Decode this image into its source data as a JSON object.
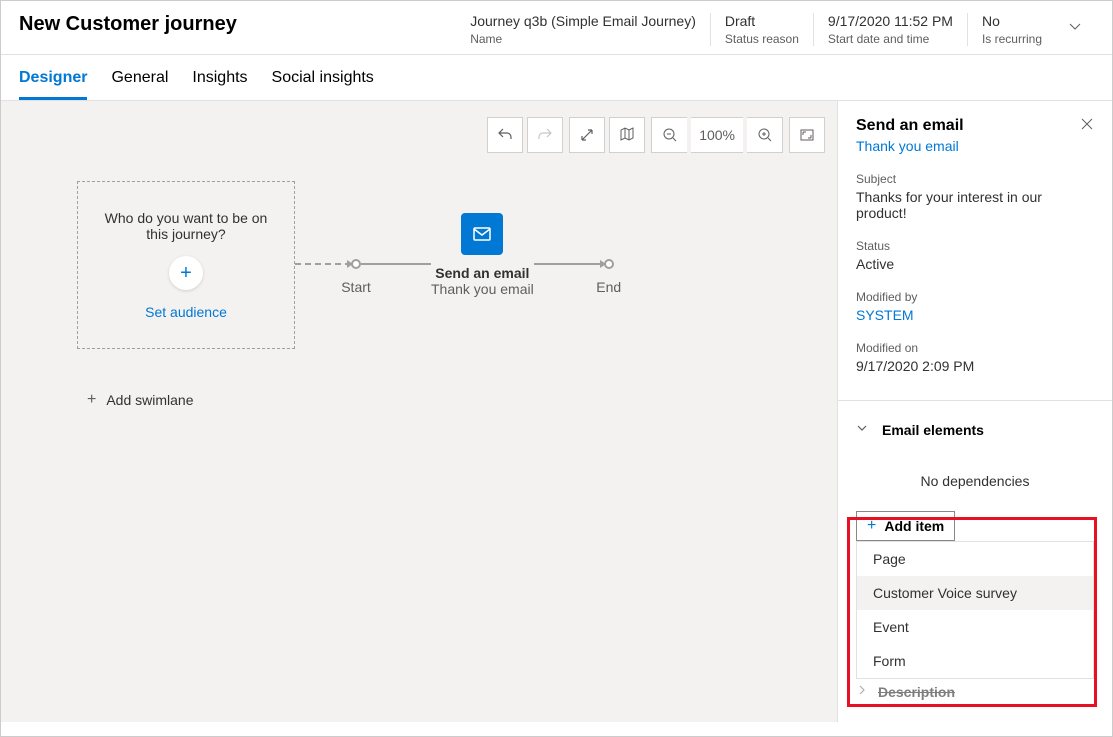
{
  "header": {
    "title": "New Customer journey",
    "meta": [
      {
        "value": "Journey q3b (Simple Email Journey)",
        "label": "Name"
      },
      {
        "value": "Draft",
        "label": "Status reason"
      },
      {
        "value": "9/17/2020 11:52 PM",
        "label": "Start date and time"
      },
      {
        "value": "No",
        "label": "Is recurring"
      }
    ]
  },
  "tabs": [
    "Designer",
    "General",
    "Insights",
    "Social insights"
  ],
  "toolbar": {
    "zoom": "100%"
  },
  "canvas": {
    "audience_prompt": "Who do you want to be on this journey?",
    "set_audience": "Set audience",
    "start_label": "Start",
    "end_label": "End",
    "email_node_title": "Send an email",
    "email_node_subtitle": "Thank you email",
    "add_swimlane": "Add swimlane"
  },
  "panel": {
    "title": "Send an email",
    "link": "Thank you email",
    "subject_label": "Subject",
    "subject_value": "Thanks for your interest in our product!",
    "status_label": "Status",
    "status_value": "Active",
    "modified_by_label": "Modified by",
    "modified_by_value": "SYSTEM",
    "modified_on_label": "Modified on",
    "modified_on_value": "9/17/2020 2:09 PM",
    "elements_section": "Email elements",
    "no_dependencies": "No dependencies",
    "add_item": "Add item",
    "dropdown": [
      "Page",
      "Customer Voice survey",
      "Event",
      "Form"
    ],
    "description_section": "Description"
  }
}
